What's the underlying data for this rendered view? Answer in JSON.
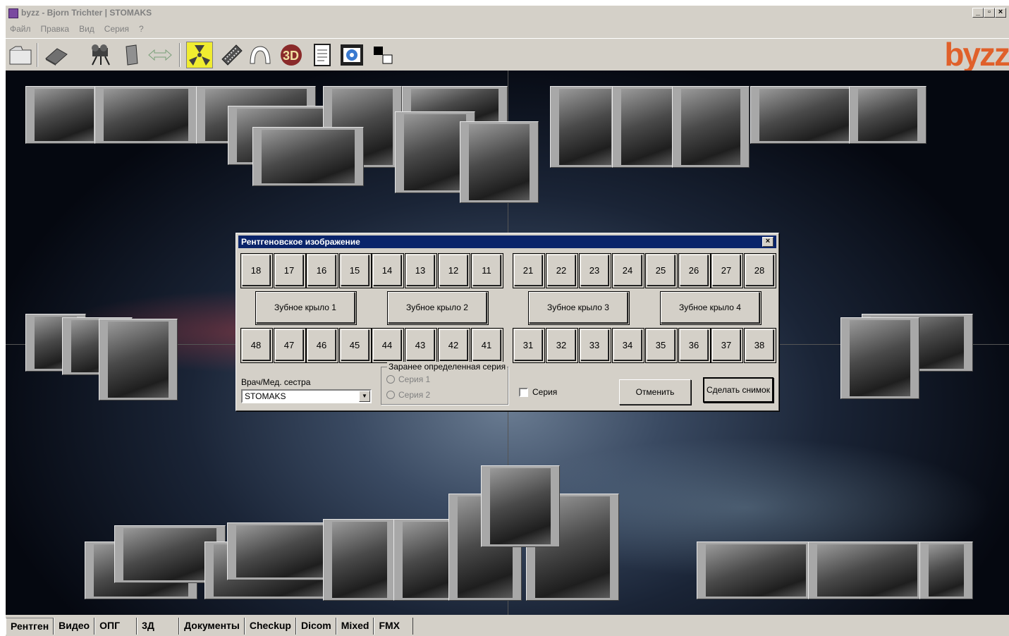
{
  "window": {
    "title": "byzz - Bjorn Trichter   | STOMAKS",
    "minimize": "_",
    "maximize": "▫",
    "close": "×"
  },
  "menu": [
    "Файл",
    "Правка",
    "Вид",
    "Серия",
    "?"
  ],
  "toolbar": {
    "brand": "byzz",
    "icons": [
      "open-folder-icon",
      "scanner-icon",
      "video-camera-icon",
      "document-icon",
      "arrows-icon",
      "xray-icon",
      "film-icon",
      "jaw-arch-icon",
      "3d-icon",
      "notes-icon",
      "media-film-icon",
      "color-swatch-icon"
    ],
    "active": "xray-icon"
  },
  "dialog": {
    "title": "Рентгеновское изображение",
    "close": "×",
    "upper_teeth": [
      "18",
      "17",
      "16",
      "15",
      "14",
      "13",
      "12",
      "11",
      "21",
      "22",
      "23",
      "24",
      "25",
      "26",
      "27",
      "28"
    ],
    "bitewings": [
      "Зубное крыло 1",
      "Зубное крыло 2",
      "Зубное крыло 3",
      "Зубное крыло 4"
    ],
    "lower_teeth": [
      "48",
      "47",
      "46",
      "45",
      "44",
      "43",
      "42",
      "41",
      "31",
      "32",
      "33",
      "34",
      "35",
      "36",
      "37",
      "38"
    ],
    "doctor_label": "Врач/Мед. сестра",
    "doctor_value": "STOMAKS",
    "group_title": "Заранее определенная серия",
    "series1": "Серия 1",
    "series2": "Серия 2",
    "series_checkbox": "Серия",
    "cancel": "Отменить",
    "take_image": "Сделать снимок"
  },
  "tabs": [
    "Рентген",
    "Видео",
    "ОПГ",
    "3Д",
    "Документы",
    "Checkup",
    "Dicom",
    "Mixed",
    "FMX"
  ],
  "selected_tab": "Рентген"
}
